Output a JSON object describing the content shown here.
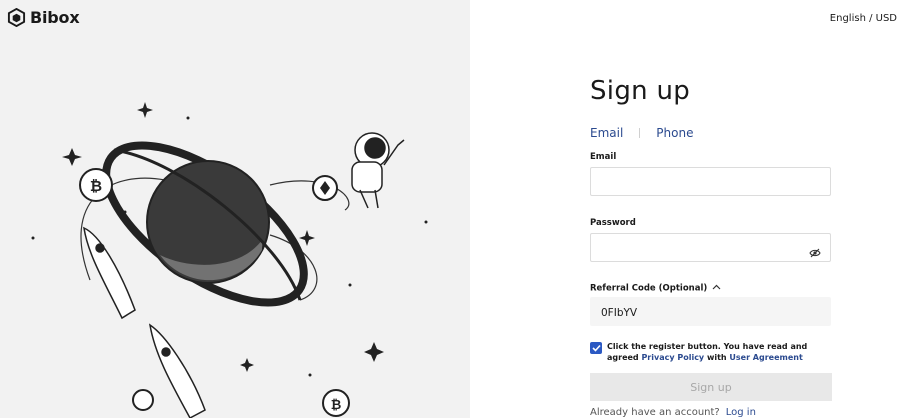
{
  "brand": {
    "name": "Bibox",
    "logo_icon": "bibox-cube-logo"
  },
  "header": {
    "language_currency": "English / USD"
  },
  "form": {
    "title": "Sign up",
    "tabs": [
      {
        "label": "Email",
        "active": true
      },
      {
        "label": "Phone",
        "active": false
      }
    ],
    "email": {
      "label": "Email",
      "value": ""
    },
    "password": {
      "label": "Password",
      "value": "",
      "icon": "eye-hidden-icon"
    },
    "referral": {
      "label": "Referral Code (Optional)",
      "value": "0FIbYV",
      "icon": "chevron-up-icon"
    },
    "agreement": {
      "checked": true,
      "text_before": "Click the register button. You have read and agreed ",
      "privacy_link": "Privacy Policy",
      "text_middle": " with ",
      "user_link": "User Agreement"
    },
    "submit_label": "Sign up",
    "footer": {
      "question": "Already have an account?",
      "login_link": "Log in"
    }
  },
  "illustration": {
    "description_icons": [
      "planet-icon",
      "astronaut-icon",
      "rocket-icon",
      "bitcoin-coin-icon",
      "ethereum-coin-icon",
      "star-icon"
    ]
  },
  "colors": {
    "accent": "#2b4a8f",
    "checkbox": "#2b59c3",
    "left_panel_bg": "#f2f2f2",
    "button_disabled": "#e8e8e8"
  }
}
